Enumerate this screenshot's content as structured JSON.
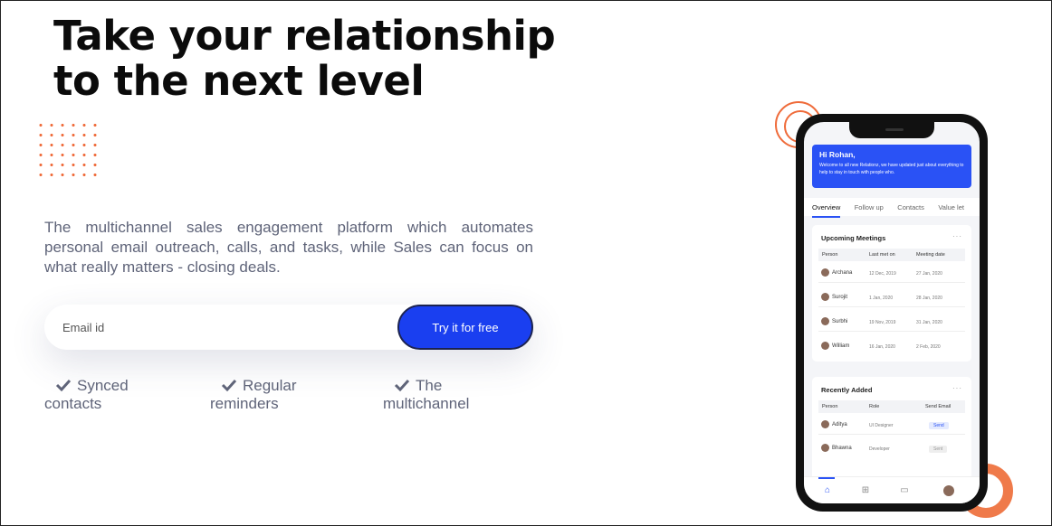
{
  "hero": {
    "title_line1": "Take your relationship",
    "title_line2": "to the next level",
    "subtitle": "The multichannel sales engagement platform which automates personal email outreach, calls, and tasks, while Sales can focus on what really matters - closing deals."
  },
  "signup": {
    "email_placeholder": "Email id",
    "cta_label": "Try it for free"
  },
  "features": [
    {
      "line1": "Synced",
      "line2": "contacts",
      "icon": "check-icon"
    },
    {
      "line1": "Regular",
      "line2": "reminders",
      "icon": "check-icon"
    },
    {
      "line1": "The",
      "line2": "multichannel",
      "icon": "check-icon"
    }
  ],
  "colors": {
    "accent_blue": "#1a3ff0",
    "accent_orange": "#ef6b3a",
    "text_gray": "#5f6479"
  },
  "phone": {
    "welcome": {
      "greeting": "Hi Rohan,",
      "message": "Welcome to all new Relationz, we have updated just about everything to help to stay in touch with people who."
    },
    "tabs": [
      "Overview",
      "Follow up",
      "Contacts",
      "Value let"
    ],
    "active_tab": "Overview",
    "upcoming": {
      "title": "Upcoming Meetings",
      "more": "···",
      "headers": [
        "Person",
        "Last met on",
        "Meeting date"
      ],
      "rows": [
        {
          "person": "Archana",
          "last_met": "12 Dec, 2019",
          "meeting": "27 Jan, 2020"
        },
        {
          "person": "Surojit",
          "last_met": "1 Jan, 2020",
          "meeting": "28 Jan, 2020"
        },
        {
          "person": "Surbhi",
          "last_met": "19 Nov, 2019",
          "meeting": "31 Jan, 2020"
        },
        {
          "person": "William",
          "last_met": "16 Jan, 2020",
          "meeting": "2 Feb, 2020"
        }
      ]
    },
    "recent": {
      "title": "Recently Added",
      "more": "···",
      "headers": [
        "Person",
        "Role",
        "Send Email"
      ],
      "rows": [
        {
          "person": "Aditya",
          "role": "UI Designer",
          "action": "Send"
        },
        {
          "person": "Bhawna",
          "role": "Developer",
          "action": "Sent"
        }
      ]
    },
    "nav_icons": [
      "home-icon",
      "grid-icon",
      "calendar-icon",
      "profile-avatar"
    ]
  }
}
